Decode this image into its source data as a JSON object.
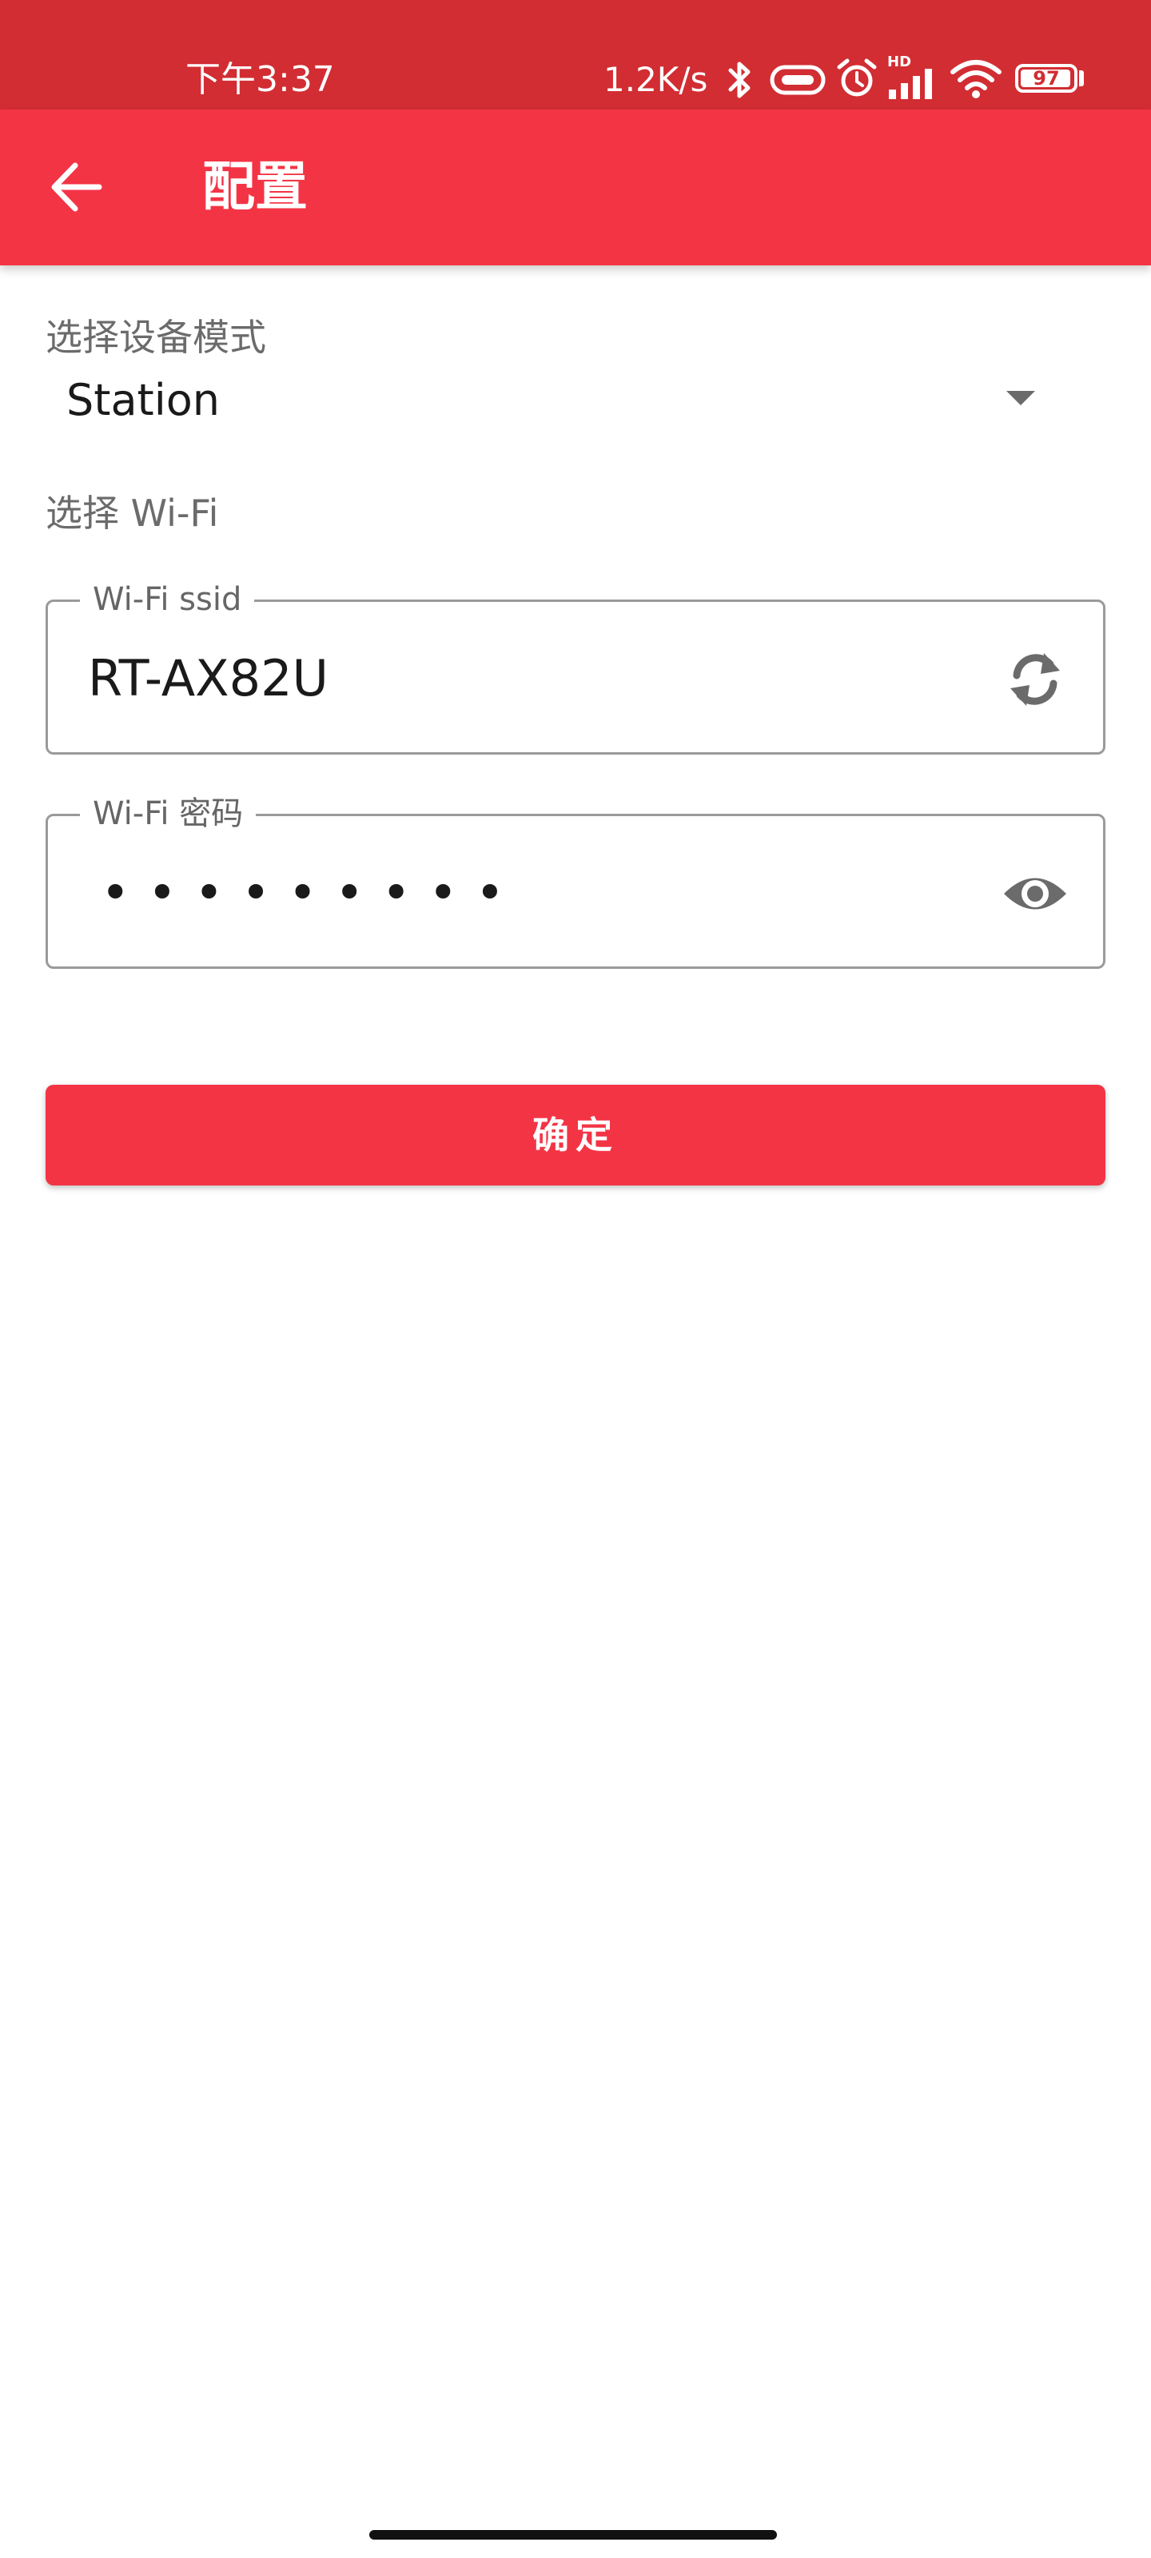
{
  "status_bar": {
    "time": "下午3:37",
    "network_speed": "1.2K/s",
    "battery_level": "97",
    "battery_fraction": 0.97,
    "icons": [
      "bluetooth-icon",
      "vibrate-icon",
      "alarm-icon",
      "hd-signal-icon",
      "wifi-icon",
      "battery-icon"
    ],
    "hd_label": "HD",
    "color": "#d12d33"
  },
  "app_bar": {
    "back_icon": "arrow-left-icon",
    "title": "配置",
    "color": "#f33445"
  },
  "form": {
    "mode_label": "选择设备模式",
    "mode_value": "Station",
    "wifi_section_label": "选择 Wi-Fi",
    "ssid": {
      "label": "Wi-Fi ssid",
      "value": "RT-AX82U",
      "icon": "refresh-icon"
    },
    "password": {
      "label": "Wi-Fi 密码",
      "masked_value": "•••••••••",
      "icon": "visibility-icon"
    },
    "confirm_button": "确定"
  }
}
